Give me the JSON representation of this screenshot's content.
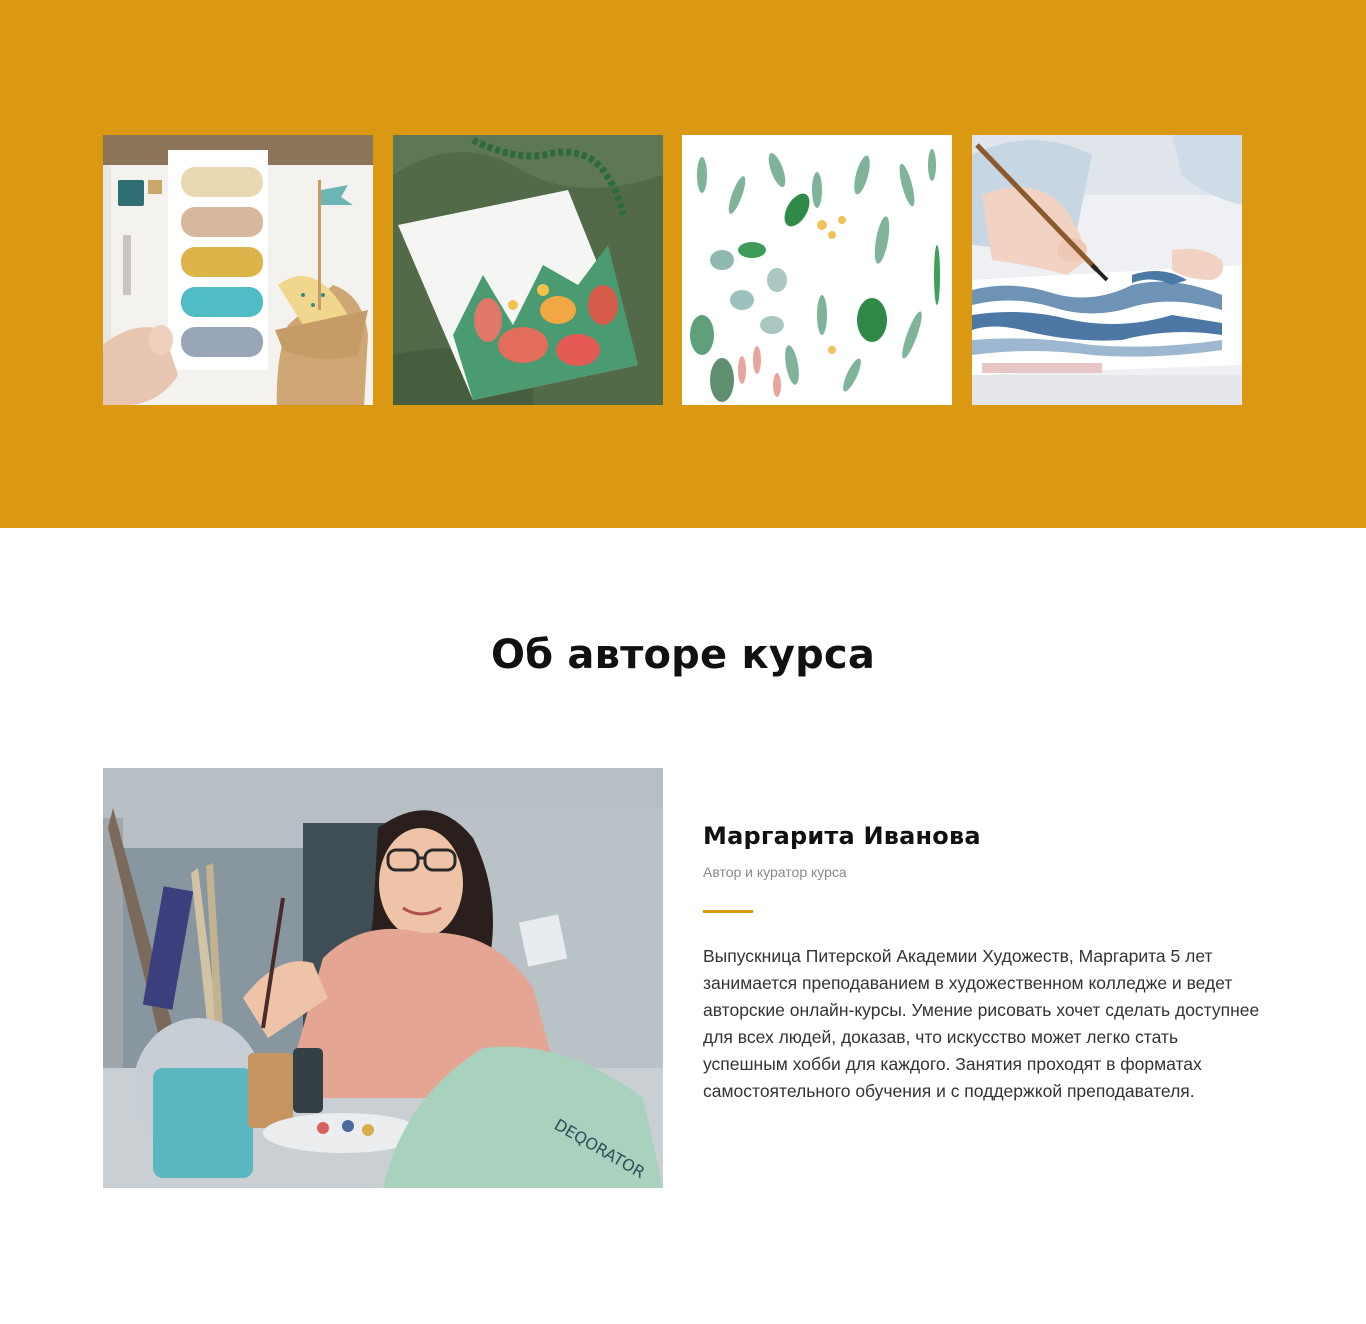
{
  "colors": {
    "accent": "#db9813",
    "heading": "#111111",
    "muted": "#8a8a8a",
    "text": "#333333"
  },
  "gallery": {
    "images": [
      {
        "name": "watercolor-swatches-photo"
      },
      {
        "name": "cactus-painting-photo"
      },
      {
        "name": "watercolor-leaves-photo"
      },
      {
        "name": "brush-painting-hand-photo"
      }
    ]
  },
  "about": {
    "title": "Об авторе курса",
    "author": {
      "name": "Маргарита Иванова",
      "role": "Автор и куратор курса",
      "bio": "Выпускница Питерской Академии Художеств, Маргарита 5 лет занимается преподаванием в художественном колледже и ведет авторские онлайн-курсы. Умение рисовать хочет сделать доступнее для всех людей, доказав, что искусство может легко стать успешным хобби для каждого. Занятия проходят в форматах самостоятельного обучения и с поддержкой преподавателя."
    }
  }
}
